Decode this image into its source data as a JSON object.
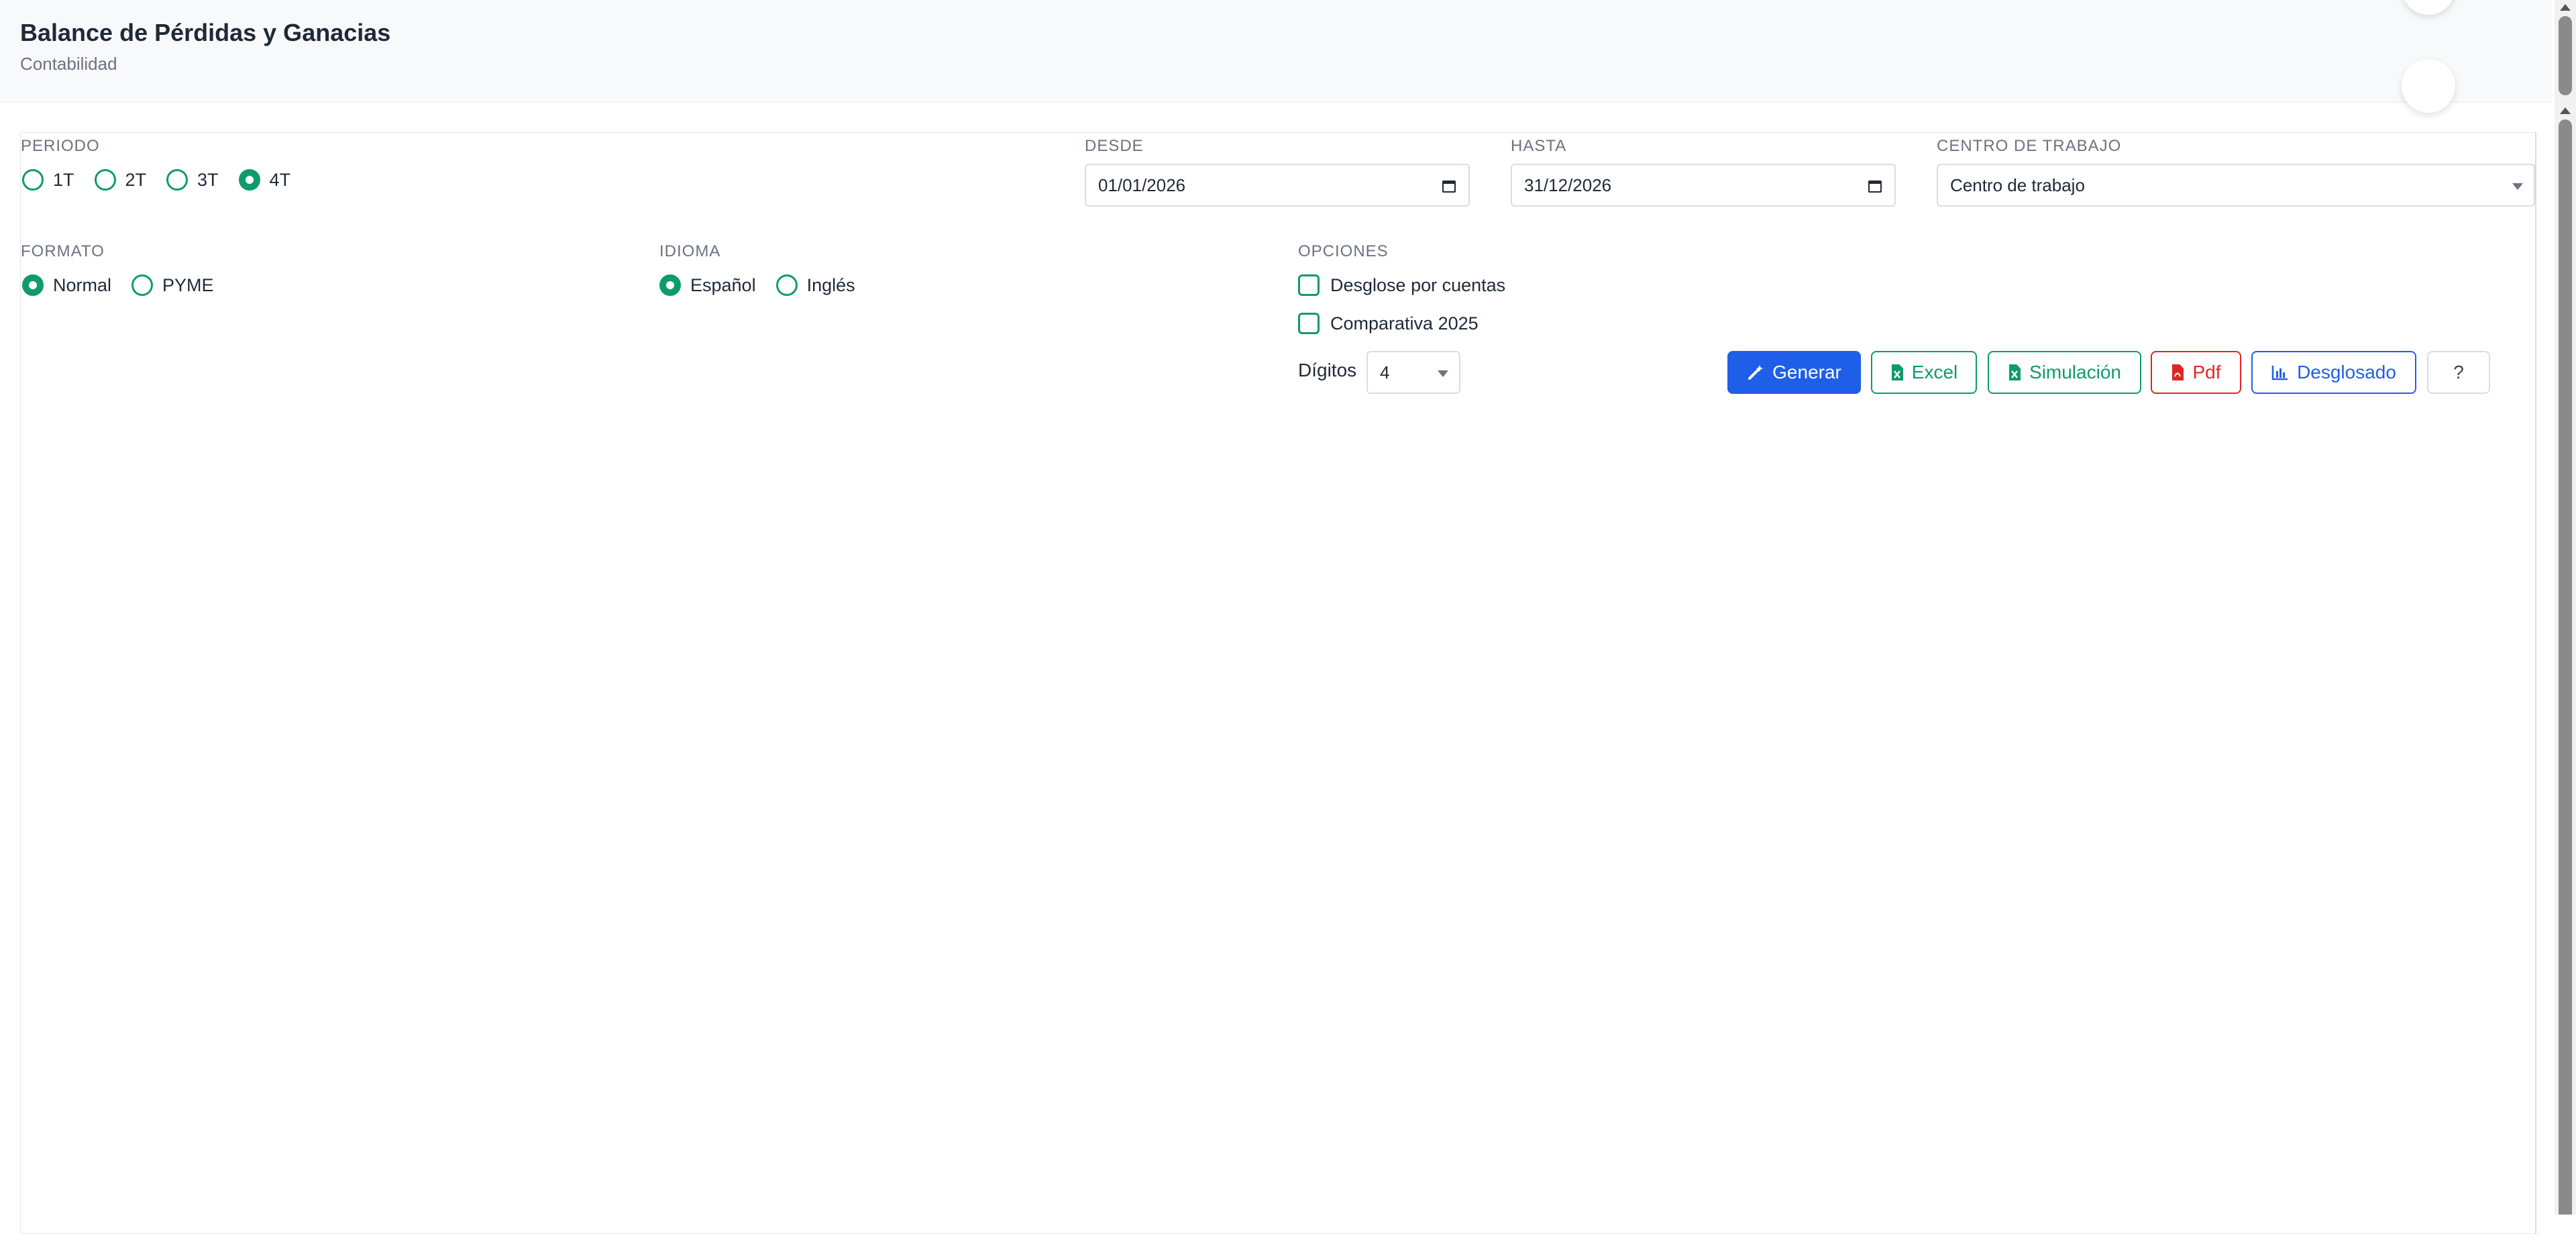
{
  "header": {
    "title": "Balance de Pérdidas y Ganacias",
    "subtitle": "Contabilidad"
  },
  "periodo": {
    "label": "PERIODO",
    "options": [
      "1T",
      "2T",
      "3T",
      "4T"
    ],
    "selected": "4T"
  },
  "desde": {
    "label": "DESDE",
    "value": "01/01/2026"
  },
  "hasta": {
    "label": "HASTA",
    "value": "31/12/2026"
  },
  "centro": {
    "label": "CENTRO DE TRABAJO",
    "value": "Centro de trabajo"
  },
  "formato": {
    "label": "FORMATO",
    "options": [
      "Normal",
      "PYME"
    ],
    "selected": "Normal"
  },
  "idioma": {
    "label": "IDIOMA",
    "options": [
      "Español",
      "Inglés"
    ],
    "selected": "Español"
  },
  "opciones": {
    "label": "OPCIONES",
    "checkboxes": [
      {
        "label": "Desglose por cuentas",
        "checked": false
      },
      {
        "label": "Comparativa 2025",
        "checked": false
      }
    ],
    "digitos_label": "Dígitos",
    "digitos_value": "4"
  },
  "buttons": {
    "generar": "Generar",
    "excel": "Excel",
    "simulacion": "Simulación",
    "pdf": "Pdf",
    "desglosado": "Desglosado",
    "help": "?"
  },
  "colors": {
    "accent_green": "#0f9b6a",
    "primary_blue": "#1f5fe8",
    "danger_red": "#dc2626"
  },
  "icons": {
    "generar": "magic-wand-icon",
    "excel": "file-excel-icon",
    "simulacion": "file-excel-icon",
    "pdf": "file-pdf-icon",
    "desglosado": "bar-chart-icon",
    "date": "calendar-icon"
  }
}
